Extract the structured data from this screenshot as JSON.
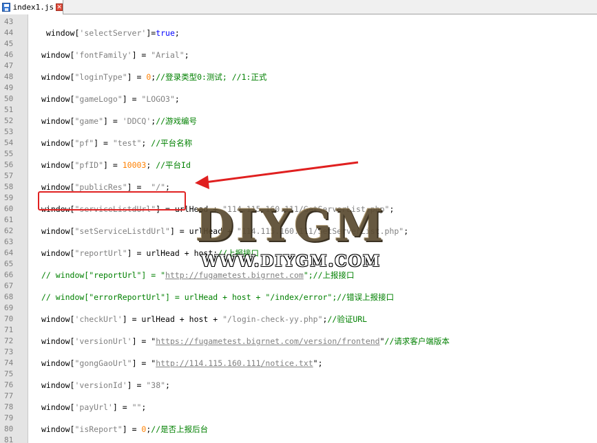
{
  "tab": {
    "filename": "index1.js",
    "close_glyph": "✕",
    "save_icon": "save-icon",
    "close_icon": "close-icon"
  },
  "watermark": {
    "title": "DIYGM",
    "url": "WWW.DIYGM.COM"
  },
  "colors": {
    "highlight": "#e02020",
    "keyword": "#0000ff",
    "comment": "#008000",
    "number": "#ff8000",
    "string": "#808080"
  },
  "lines": [
    {
      "n": "43",
      "tokens": []
    },
    {
      "n": "44",
      "tokens": [
        {
          "t": " window[",
          "c": ""
        },
        {
          "t": "'selectServer'",
          "c": "str"
        },
        {
          "t": "]=",
          "c": ""
        },
        {
          "t": "true",
          "c": "kw"
        },
        {
          "t": ";",
          "c": ""
        }
      ]
    },
    {
      "n": "45",
      "tokens": []
    },
    {
      "n": "46",
      "tokens": [
        {
          "t": "window[",
          "c": ""
        },
        {
          "t": "'fontFamily'",
          "c": "str"
        },
        {
          "t": "] = ",
          "c": ""
        },
        {
          "t": "\"Arial\"",
          "c": "str"
        },
        {
          "t": ";",
          "c": ""
        }
      ]
    },
    {
      "n": "47",
      "tokens": []
    },
    {
      "n": "48",
      "tokens": [
        {
          "t": "window[",
          "c": ""
        },
        {
          "t": "\"loginType\"",
          "c": "str"
        },
        {
          "t": "] = ",
          "c": ""
        },
        {
          "t": "0",
          "c": "num"
        },
        {
          "t": ";",
          "c": ""
        },
        {
          "t": "//登录类型0:测试; //1:正式",
          "c": "cm"
        }
      ]
    },
    {
      "n": "49",
      "tokens": []
    },
    {
      "n": "50",
      "tokens": [
        {
          "t": "window[",
          "c": ""
        },
        {
          "t": "\"gameLogo\"",
          "c": "str"
        },
        {
          "t": "] = ",
          "c": ""
        },
        {
          "t": "\"LOGO3\"",
          "c": "str"
        },
        {
          "t": ";",
          "c": ""
        }
      ]
    },
    {
      "n": "51",
      "tokens": []
    },
    {
      "n": "52",
      "tokens": [
        {
          "t": "window[",
          "c": ""
        },
        {
          "t": "\"game\"",
          "c": "str"
        },
        {
          "t": "] = ",
          "c": ""
        },
        {
          "t": "'DDCQ'",
          "c": "str"
        },
        {
          "t": ";",
          "c": ""
        },
        {
          "t": "//游戏编号",
          "c": "cm"
        }
      ]
    },
    {
      "n": "53",
      "tokens": []
    },
    {
      "n": "54",
      "tokens": [
        {
          "t": "window[",
          "c": ""
        },
        {
          "t": "\"pf\"",
          "c": "str"
        },
        {
          "t": "] = ",
          "c": ""
        },
        {
          "t": "\"test\"",
          "c": "str"
        },
        {
          "t": "; ",
          "c": ""
        },
        {
          "t": "//平台名称",
          "c": "cm"
        }
      ]
    },
    {
      "n": "55",
      "tokens": []
    },
    {
      "n": "56",
      "tokens": [
        {
          "t": "window[",
          "c": ""
        },
        {
          "t": "\"pfID\"",
          "c": "str"
        },
        {
          "t": "] = ",
          "c": ""
        },
        {
          "t": "10003",
          "c": "num"
        },
        {
          "t": "; ",
          "c": ""
        },
        {
          "t": "//平台Id",
          "c": "cm"
        }
      ]
    },
    {
      "n": "57",
      "tokens": []
    },
    {
      "n": "58",
      "tokens": [
        {
          "t": "window[",
          "c": ""
        },
        {
          "t": "\"publicRes\"",
          "c": "str"
        },
        {
          "t": "] =  ",
          "c": ""
        },
        {
          "t": "\"/\"",
          "c": "str"
        },
        {
          "t": ";",
          "c": ""
        }
      ]
    },
    {
      "n": "59",
      "tokens": []
    },
    {
      "n": "60",
      "tokens": [
        {
          "t": "window[",
          "c": ""
        },
        {
          "t": "\"serviceListdUrl\"",
          "c": "str"
        },
        {
          "t": "] = urlHead + ",
          "c": ""
        },
        {
          "t": "\"114.115.160.111/GetServerList.php\"",
          "c": "str"
        },
        {
          "t": ";",
          "c": ""
        }
      ]
    },
    {
      "n": "61",
      "tokens": []
    },
    {
      "n": "62",
      "tokens": [
        {
          "t": "window[",
          "c": ""
        },
        {
          "t": "\"setServiceListdUrl\"",
          "c": "str"
        },
        {
          "t": "] = urlHead + ",
          "c": ""
        },
        {
          "t": "\"114.115.160.111/SetServerList.php\"",
          "c": "str"
        },
        {
          "t": ";",
          "c": ""
        }
      ]
    },
    {
      "n": "63",
      "tokens": []
    },
    {
      "n": "64",
      "tokens": [
        {
          "t": "window[",
          "c": ""
        },
        {
          "t": "\"reportUrl\"",
          "c": "str"
        },
        {
          "t": "] = urlHead + host;",
          "c": ""
        },
        {
          "t": "//上报接口",
          "c": "cm"
        }
      ]
    },
    {
      "n": "65",
      "tokens": []
    },
    {
      "n": "66",
      "tokens": [
        {
          "t": "// window[\"reportUrl\"] = \"",
          "c": "cm"
        },
        {
          "t": "http://fugametest.bigrnet.com",
          "c": "link"
        },
        {
          "t": "\";//上报接口",
          "c": "cm"
        }
      ]
    },
    {
      "n": "67",
      "tokens": []
    },
    {
      "n": "68",
      "tokens": [
        {
          "t": "// window[\"errorReportUrl\"] = urlHead + host + \"/index/error\";//错误上报接口",
          "c": "cm"
        }
      ]
    },
    {
      "n": "69",
      "tokens": []
    },
    {
      "n": "70",
      "tokens": [
        {
          "t": "window[",
          "c": ""
        },
        {
          "t": "'checkUrl'",
          "c": "str"
        },
        {
          "t": "] = urlHead + host + ",
          "c": ""
        },
        {
          "t": "\"/login-check-yy.php\"",
          "c": "str"
        },
        {
          "t": ";",
          "c": ""
        },
        {
          "t": "//验证URL",
          "c": "cm"
        }
      ]
    },
    {
      "n": "71",
      "tokens": []
    },
    {
      "n": "72",
      "tokens": [
        {
          "t": "window[",
          "c": ""
        },
        {
          "t": "'versionUrl'",
          "c": "str"
        },
        {
          "t": "] = \"",
          "c": ""
        },
        {
          "t": "https://fugametest.bigrnet.com/version/frontend",
          "c": "link"
        },
        {
          "t": "\"",
          "c": ""
        },
        {
          "t": "//请求客户端版本",
          "c": "cm"
        }
      ]
    },
    {
      "n": "73",
      "tokens": []
    },
    {
      "n": "74",
      "tokens": [
        {
          "t": "window[",
          "c": ""
        },
        {
          "t": "\"gongGaoUrl\"",
          "c": "str"
        },
        {
          "t": "] = \"",
          "c": ""
        },
        {
          "t": "http://114.115.160.111/notice.txt",
          "c": "link"
        },
        {
          "t": "\";",
          "c": ""
        }
      ]
    },
    {
      "n": "75",
      "tokens": []
    },
    {
      "n": "76",
      "tokens": [
        {
          "t": "window[",
          "c": ""
        },
        {
          "t": "'versionId'",
          "c": "str"
        },
        {
          "t": "] = ",
          "c": ""
        },
        {
          "t": "\"38\"",
          "c": "str"
        },
        {
          "t": ";",
          "c": ""
        }
      ]
    },
    {
      "n": "77",
      "tokens": []
    },
    {
      "n": "78",
      "tokens": [
        {
          "t": "window[",
          "c": ""
        },
        {
          "t": "'payUrl'",
          "c": "str"
        },
        {
          "t": "] = ",
          "c": ""
        },
        {
          "t": "\"\"",
          "c": "str"
        },
        {
          "t": ";",
          "c": ""
        }
      ]
    },
    {
      "n": "79",
      "tokens": []
    },
    {
      "n": "80",
      "tokens": [
        {
          "t": "window[",
          "c": ""
        },
        {
          "t": "\"isReport\"",
          "c": "str"
        },
        {
          "t": "] = ",
          "c": ""
        },
        {
          "t": "0",
          "c": "num"
        },
        {
          "t": ";",
          "c": ""
        },
        {
          "t": "//是否上报后台",
          "c": "cm"
        }
      ]
    },
    {
      "n": "81",
      "tokens": []
    }
  ]
}
